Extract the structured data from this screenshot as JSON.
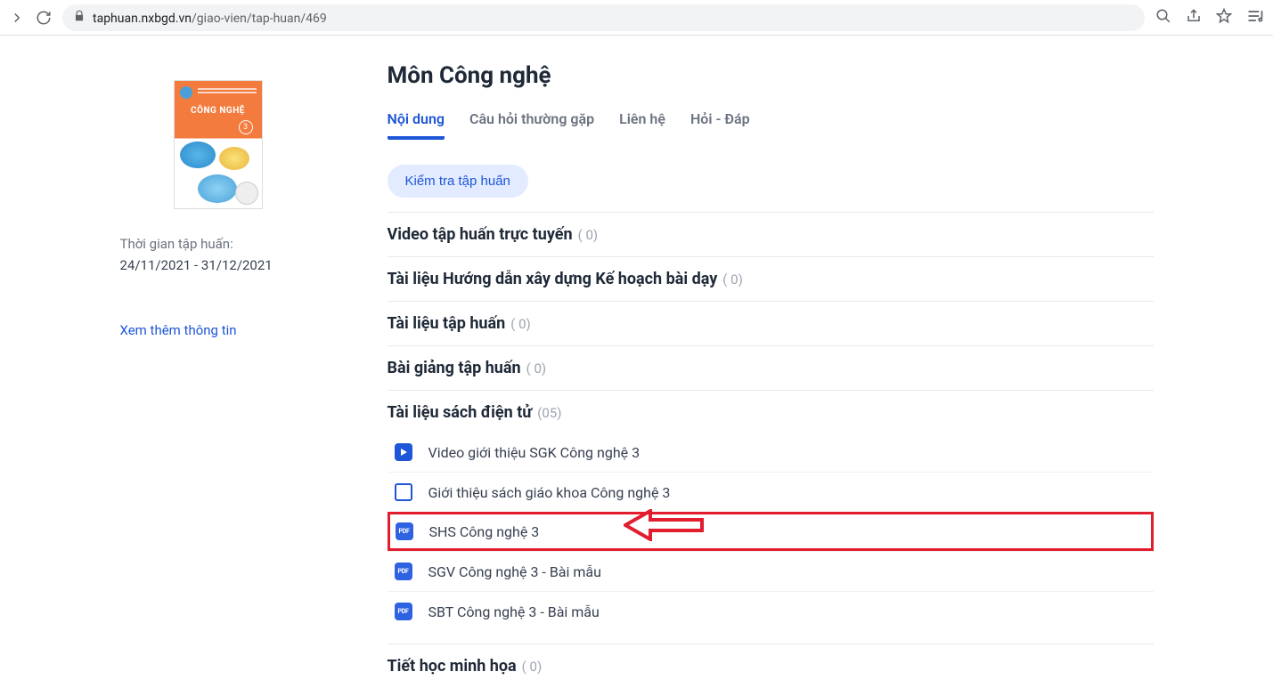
{
  "browser": {
    "url_host": "taphuan.nxbgd.vn",
    "url_path": "/giao-vien/tap-huan/469"
  },
  "sidebar": {
    "cover_title": "CÔNG NGHỆ",
    "cover_grade": "3",
    "time_label": "Thời gian tập huấn:",
    "time_range": "24/11/2021 - 31/12/2021",
    "more_info": "Xem thêm thông tin"
  },
  "main": {
    "title": "Môn Công nghệ",
    "tabs": [
      {
        "label": "Nội dung",
        "active": true
      },
      {
        "label": "Câu hỏi thường gặp",
        "active": false
      },
      {
        "label": "Liên hệ",
        "active": false
      },
      {
        "label": "Hỏi - Đáp",
        "active": false
      }
    ],
    "check_button": "Kiểm tra tập huấn",
    "sections": [
      {
        "title": "Video tập huấn trực tuyến",
        "count": "( 0)"
      },
      {
        "title": "Tài liệu Hướng dẫn xây dựng Kế hoạch bài dạy",
        "count": "( 0)"
      },
      {
        "title": "Tài liệu tập huấn",
        "count": "( 0)"
      },
      {
        "title": "Bài giảng tập huấn",
        "count": "( 0)"
      },
      {
        "title": "Tài liệu sách điện tử",
        "count": "(05)",
        "items": [
          {
            "icon": "video",
            "label": "Video giới thiệu SGK Công nghệ 3"
          },
          {
            "icon": "doc",
            "label": "Giới thiệu sách giáo khoa Công nghệ 3"
          },
          {
            "icon": "pdf",
            "label": "SHS Công nghệ 3",
            "highlighted": true
          },
          {
            "icon": "pdf",
            "label": "SGV Công nghệ 3 - Bài mẫu"
          },
          {
            "icon": "pdf",
            "label": "SBT Công nghệ 3 - Bài mẫu"
          }
        ]
      },
      {
        "title": "Tiết học minh họa",
        "count": "( 0)"
      }
    ]
  },
  "icon_text": {
    "pdf": "PDF"
  }
}
